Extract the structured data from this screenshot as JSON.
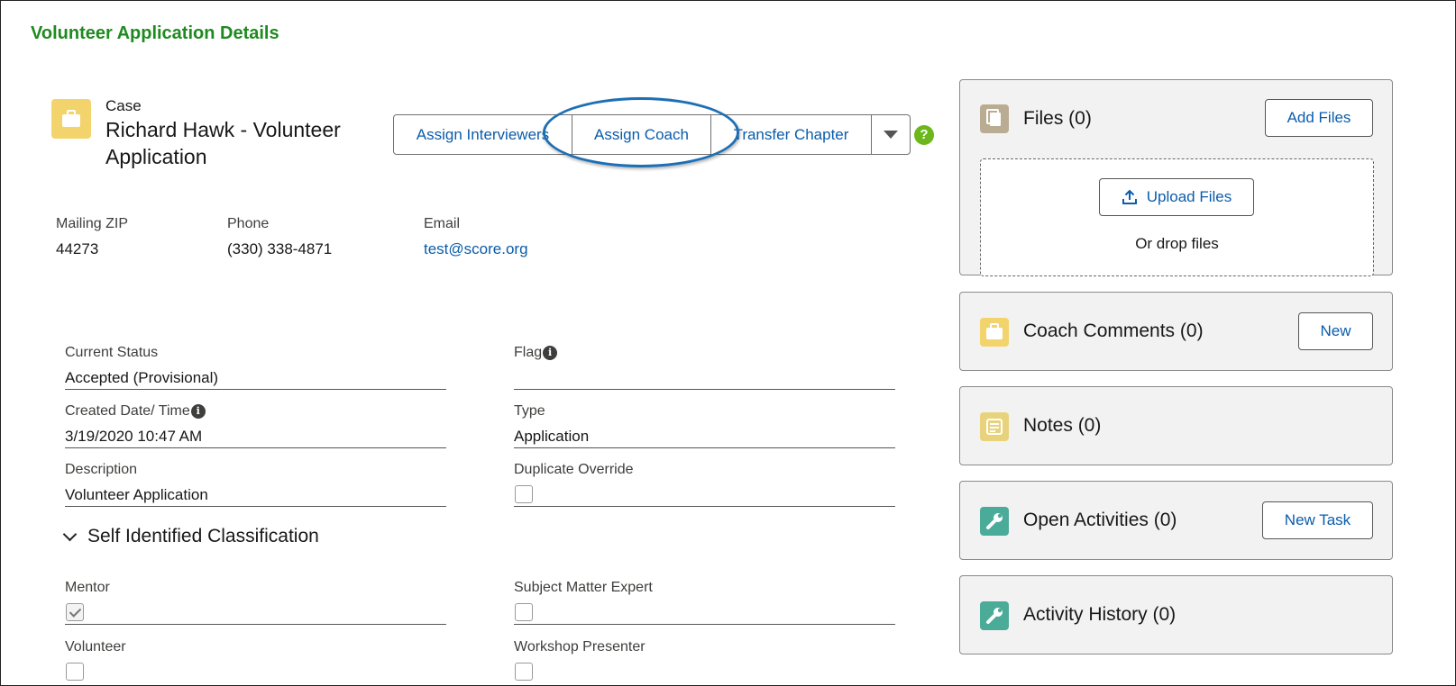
{
  "page_title": "Volunteer Application Details",
  "record": {
    "object_label": "Case",
    "title": "Richard Hawk - Volunteer Application",
    "icon": "briefcase-icon",
    "icon_color": "#f3d36b"
  },
  "actions": {
    "assign_interviewers": "Assign Interviewers",
    "assign_coach": "Assign Coach",
    "transfer_chapter": "Transfer Chapter",
    "more_icon": "chevron-down-icon",
    "help_icon_text": "?",
    "highlighted_action": "Assign Coach",
    "highlight_color": "#1d6fb5"
  },
  "highlights": [
    {
      "label": "Mailing ZIP",
      "value": "44273"
    },
    {
      "label": "Phone",
      "value": "(330) 338-4871"
    },
    {
      "label": "Email",
      "value": "test@score.org"
    }
  ],
  "fields": {
    "current_status": {
      "label": "Current Status",
      "value": "Accepted (Provisional)"
    },
    "flag": {
      "label": "Flag",
      "value": ""
    },
    "created": {
      "label": "Created Date/ Time",
      "value": "3/19/2020 10:47 AM"
    },
    "type": {
      "label": "Type",
      "value": "Application"
    },
    "description": {
      "label": "Description",
      "value": "Volunteer Application"
    },
    "duplicate_override": {
      "label": "Duplicate Override",
      "checked": false
    }
  },
  "section": {
    "title": "Self Identified Classification",
    "expanded": true,
    "fields": {
      "mentor": {
        "label": "Mentor",
        "checked": true
      },
      "subject_matter_expert": {
        "label": "Subject Matter Expert",
        "checked": false
      },
      "volunteer": {
        "label": "Volunteer",
        "checked": false
      },
      "workshop_presenter": {
        "label": "Workshop Presenter",
        "checked": false
      }
    }
  },
  "related": {
    "files": {
      "title": "Files (0)",
      "button": "Add Files",
      "upload_button": "Upload Files",
      "drop_text": "Or drop files",
      "icon": "file-icon",
      "icon_color": "#baac93"
    },
    "coach_comments": {
      "title": "Coach Comments (0)",
      "button": "New",
      "icon": "briefcase-icon",
      "icon_color": "#f3d36b"
    },
    "notes": {
      "title": "Notes (0)",
      "icon": "note-icon",
      "icon_color": "#e8d37c"
    },
    "open_activities": {
      "title": "Open Activities (0)",
      "button": "New Task",
      "icon": "wrench-icon",
      "icon_color": "#4bab99"
    },
    "activity_history": {
      "title": "Activity History (0)",
      "icon": "wrench-icon",
      "icon_color": "#4bab99"
    }
  }
}
